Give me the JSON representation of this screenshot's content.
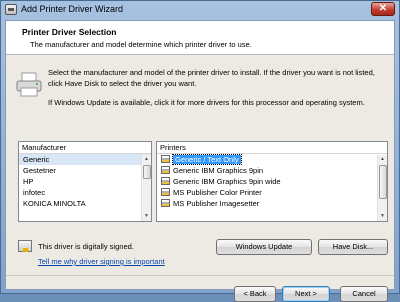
{
  "window": {
    "title": "Add Printer Driver Wizard",
    "close_label": "✕"
  },
  "header": {
    "title": "Printer Driver Selection",
    "subtitle": "The manufacturer and model determine which printer driver to use."
  },
  "description": {
    "line1": "Select the manufacturer and model of the printer driver to install. If the driver you want is not listed, click Have Disk to select the driver you want.",
    "line2": "If Windows Update is available, click it for more drivers for this processor and operating system."
  },
  "manufacturer_list": {
    "header": "Manufacturer",
    "items": [
      "Generic",
      "Gestetner",
      "HP",
      "infotec",
      "KONICA MINOLTA"
    ],
    "selected": "Generic"
  },
  "printer_list": {
    "header": "Printers",
    "items": [
      "Generic / Text Only",
      "Generic IBM Graphics 9pin",
      "Generic IBM Graphics 9pin wide",
      "MS Publisher Color Printer",
      "MS Publisher Imagesetter"
    ],
    "selected": "Generic / Text Only"
  },
  "signature": {
    "text": "This driver is digitally signed.",
    "link": "Tell me why driver signing is important"
  },
  "buttons": {
    "windows_update": "Windows Update",
    "have_disk": "Have Disk...",
    "back": "< Back",
    "next": "Next >",
    "cancel": "Cancel"
  },
  "icons": [
    "printer-icon",
    "certificate-icon",
    "close-icon"
  ]
}
